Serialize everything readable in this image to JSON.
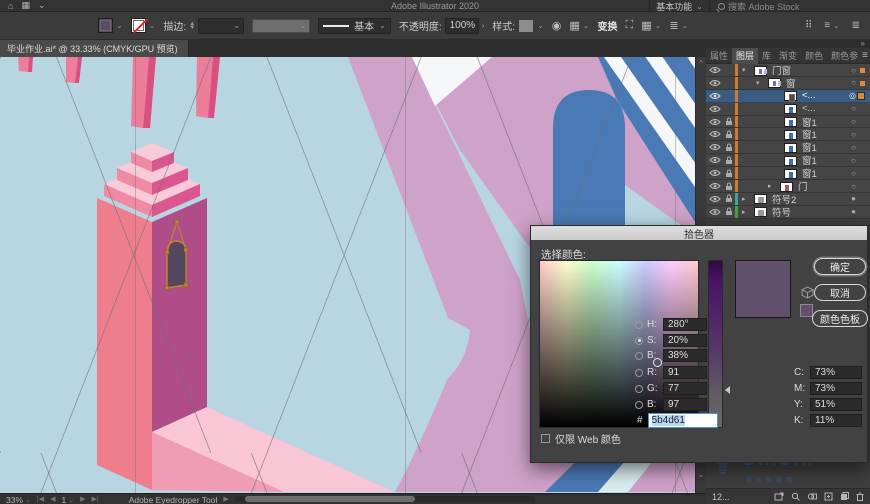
{
  "app": {
    "title": "Adobe Illustrator 2020",
    "workspace_label": "基本功能",
    "search_placeholder": "搜索 Adobe Stock"
  },
  "control_bar": {
    "stroke_label": "描边:",
    "brush_label": "基本",
    "opacity_label": "不透明度:",
    "opacity_value": "100%",
    "style_label": "样式:",
    "transform_label": "变换"
  },
  "doc_tab": {
    "label": "毕业作业.ai* @ 33.33% (CMYK/GPU 预览)"
  },
  "panels": {
    "tabs": [
      {
        "label": "属性"
      },
      {
        "label": "图层"
      },
      {
        "label": "库"
      },
      {
        "label": "渐变"
      },
      {
        "label": "颜色"
      },
      {
        "label": "颜色参"
      }
    ],
    "layers": [
      {
        "name": "门窗"
      },
      {
        "name": "窗"
      },
      {
        "name": "<..."
      },
      {
        "name": "<..."
      },
      {
        "name": "窗1"
      },
      {
        "name": "窗1"
      },
      {
        "name": "窗1"
      },
      {
        "name": "窗1"
      },
      {
        "name": "窗1"
      },
      {
        "name": "门"
      },
      {
        "name": "符号2"
      },
      {
        "name": "符号"
      }
    ],
    "footer_count": "12..."
  },
  "picker": {
    "title": "拾色器",
    "select_label": "选择颜色:",
    "ok": "确定",
    "cancel": "取消",
    "swatches": "颜色色板",
    "hsb": [
      {
        "label": "H:",
        "value": "280°"
      },
      {
        "label": "S:",
        "value": "20%"
      },
      {
        "label": "B:",
        "value": "38%"
      }
    ],
    "rgb": [
      {
        "label": "R:",
        "value": "91"
      },
      {
        "label": "G:",
        "value": "77"
      },
      {
        "label": "B:",
        "value": "97"
      }
    ],
    "cmyk": [
      {
        "label": "C:",
        "value": "73%"
      },
      {
        "label": "M:",
        "value": "73%"
      },
      {
        "label": "Y:",
        "value": "51%"
      },
      {
        "label": "K:",
        "value": "11%"
      }
    ],
    "hex_prefix": "#",
    "hex": "5b4d61",
    "web_only_label": "仅限 Web 颜色"
  },
  "statusbar": {
    "zoom": "33%",
    "artboard": "1",
    "tool": "Adobe Eyedropper Tool"
  },
  "watermark": {
    "title": "UiiiUiii",
    "subtitle": "优优教程网"
  },
  "glyphs": {
    "home": "⌂",
    "grid": "▦",
    "chevron": "⌄",
    "tri_down": "▾",
    "tri_right": "▸",
    "ring": "○",
    "dbl_ring": "◎",
    "dot": "●",
    "menu": "≡",
    "dbl_chev": "»",
    "caret_up": "^",
    "caret_down": "⌄",
    "more": "›",
    "dots": "⠿",
    "lines": "≣",
    "wheel": "◉",
    "expand": "⛶",
    "nav_first": "|◀",
    "nav_prev": "◀",
    "nav_next": "▶",
    "nav_last": "▶|",
    "play": "▶"
  },
  "colors": {
    "canvas_bg": "#B8D5E2",
    "fill_swatch": "#5B4D61",
    "picker_color": "#60506B",
    "salmon": "#EE7E8C",
    "magenta": "#B04C87",
    "pink_light": "#F9C6D5",
    "pink_mid": "#F09CB4",
    "pillar_pink": "#EC7E9B",
    "pillar_dark": "#D94F7E",
    "tier_top": "#F9CADA",
    "tier_front": "#EF8AA4",
    "tier_side": "#D9568E",
    "mauve": "#CFA2C9",
    "arch_blue": "#4A7AB5",
    "stripe_blue": "#4A7AB5",
    "stripe_white": "#F4F6F7",
    "cyan_band": "#D9EEF0",
    "door_fill": "#53475E",
    "door_stroke": "#C08437",
    "bar_orange": "#CF7A2E",
    "bar_teal": "#3AA6A0",
    "bar_green": "#4AA14A",
    "sel_square": "#D98A3C",
    "watermark_blue": "#2F6BC9"
  }
}
